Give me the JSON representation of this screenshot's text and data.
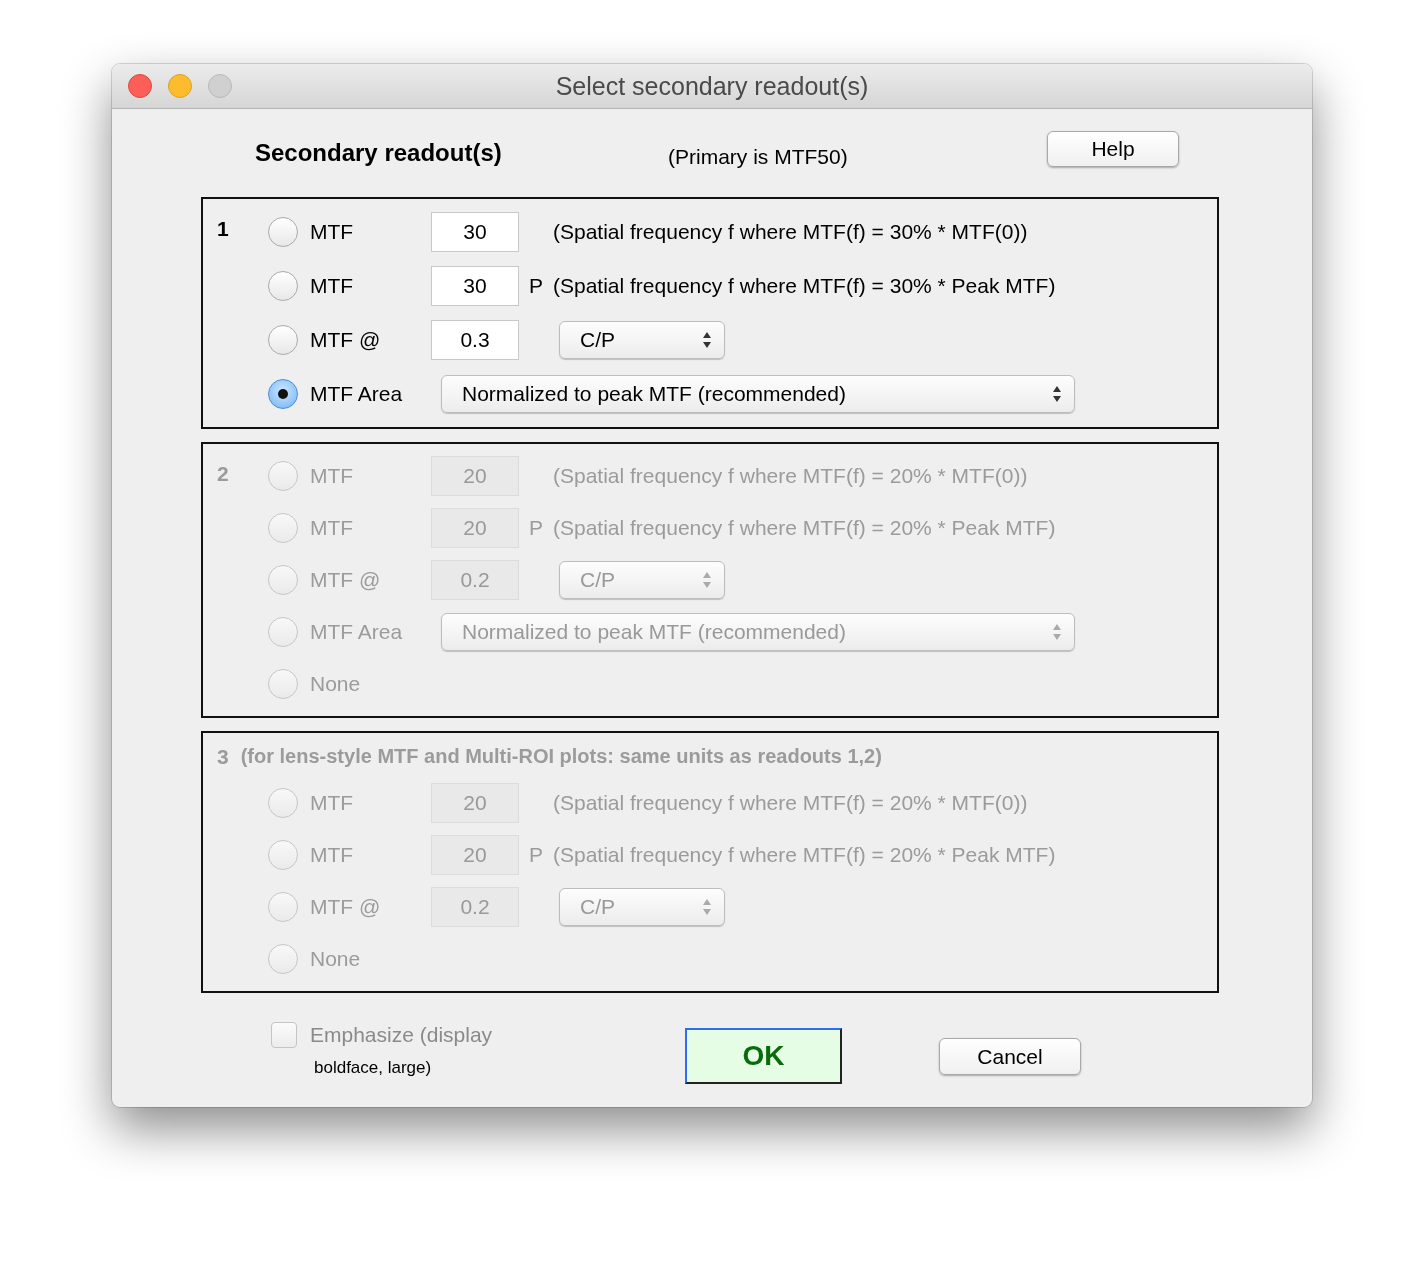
{
  "window": {
    "title": "Select secondary readout(s)"
  },
  "header": {
    "title": "Secondary readout(s)",
    "primary_note": "(Primary is MTF50)",
    "help_button": "Help"
  },
  "groups": [
    {
      "number": "1",
      "disabled": false,
      "options": [
        {
          "kind": "threshold",
          "label": "MTF",
          "value": "30",
          "description": "(Spatial frequency f where MTF(f) = 30% * MTF(0))",
          "selected": false
        },
        {
          "kind": "threshold",
          "label": "MTF",
          "value": "30",
          "suffix": "P",
          "description": "(Spatial frequency f where MTF(f) = 30% * Peak MTF)",
          "selected": false
        },
        {
          "kind": "at",
          "label": "MTF @",
          "value": "0.3",
          "unit": "C/P",
          "selected": false
        },
        {
          "kind": "area",
          "label": "MTF Area",
          "choice": "Normalized to peak MTF (recommended)",
          "selected": true
        }
      ]
    },
    {
      "number": "2",
      "disabled": true,
      "options": [
        {
          "kind": "threshold",
          "label": "MTF",
          "value": "20",
          "description": "(Spatial frequency f where MTF(f) = 20% * MTF(0))",
          "selected": false
        },
        {
          "kind": "threshold",
          "label": "MTF",
          "value": "20",
          "suffix": "P",
          "description": "(Spatial frequency f where MTF(f) = 20% * Peak MTF)",
          "selected": false
        },
        {
          "kind": "at",
          "label": "MTF @",
          "value": "0.2",
          "unit": "C/P",
          "selected": false
        },
        {
          "kind": "area",
          "label": "MTF Area",
          "choice": "Normalized to peak MTF (recommended)",
          "selected": false
        },
        {
          "kind": "none",
          "label": "None",
          "selected": false
        }
      ]
    },
    {
      "number": "3",
      "title": "(for lens-style MTF and Multi-ROI plots:  same units as readouts 1,2)",
      "disabled": true,
      "options": [
        {
          "kind": "threshold",
          "label": "MTF",
          "value": "20",
          "description": "(Spatial frequency f where MTF(f) = 20% * MTF(0))",
          "selected": false
        },
        {
          "kind": "threshold",
          "label": "MTF",
          "value": "20",
          "suffix": "P",
          "description": "(Spatial frequency f where MTF(f) = 20% * Peak MTF)",
          "selected": false
        },
        {
          "kind": "at",
          "label": "MTF @",
          "value": "0.2",
          "unit": "C/P",
          "selected": false
        },
        {
          "kind": "none",
          "label": "None",
          "selected": false
        }
      ]
    }
  ],
  "emphasize": {
    "label": "Emphasize (display",
    "note": "boldface, large)",
    "checked": false
  },
  "buttons": {
    "ok": "OK",
    "cancel": "Cancel"
  }
}
